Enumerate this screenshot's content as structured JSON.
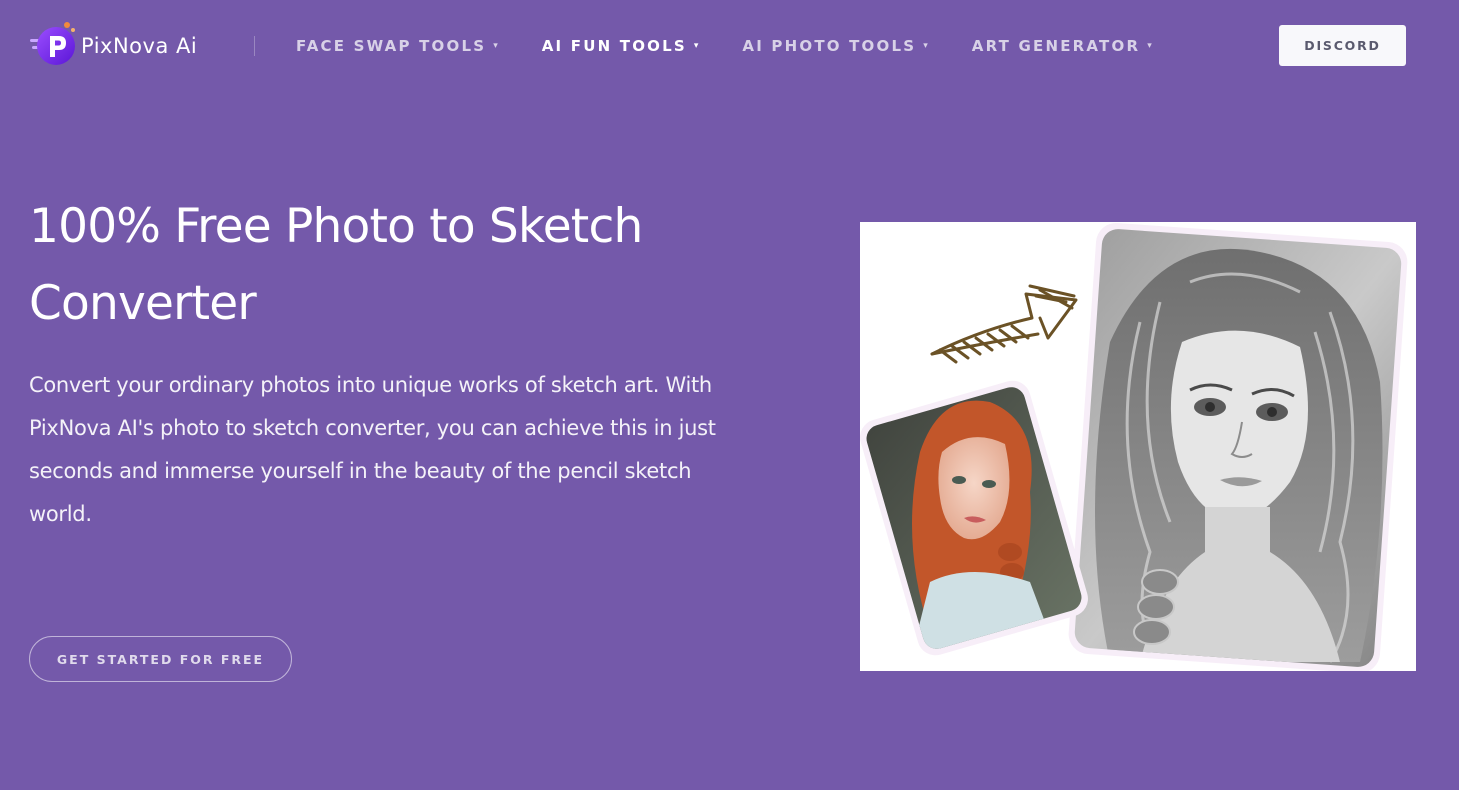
{
  "header": {
    "logo_alt": "PixNova AI",
    "logo_text": "PixNova",
    "logo_suffix": "Ai",
    "nav": [
      {
        "label": "FACE SWAP TOOLS",
        "active": false
      },
      {
        "label": "AI FUN TOOLS",
        "active": true
      },
      {
        "label": "AI PHOTO TOOLS",
        "active": false
      },
      {
        "label": "ART GENERATOR",
        "active": false
      }
    ],
    "discord_label": "DISCORD"
  },
  "hero": {
    "title": "100% Free Photo to Sketch Converter",
    "description": "Convert your ordinary photos into unique works of sketch art. With PixNova AI's photo to sketch converter, you can achieve this in just seconds and immerse yourself in the beauty of the pencil sketch world.",
    "cta_label": "GET STARTED FOR FREE"
  },
  "colors": {
    "background": "#7459aa",
    "logo_purple": "#7b2ff2",
    "logo_orange": "#f28a3a",
    "arrow_brown": "#6b5226"
  }
}
